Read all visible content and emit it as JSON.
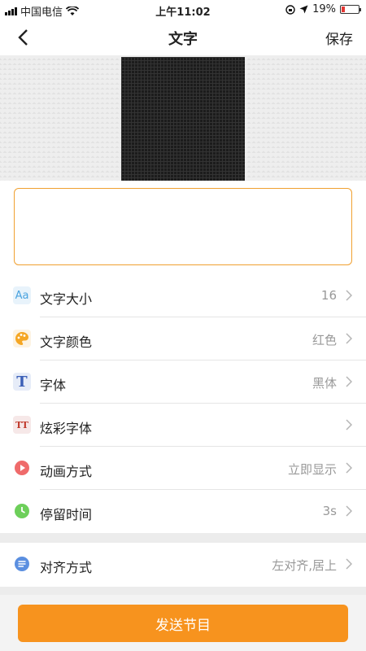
{
  "status_bar": {
    "carrier": "中国电信",
    "time": "上午11:02",
    "battery": "19%",
    "battery_level": 0.19
  },
  "nav": {
    "title": "文字",
    "save_label": "保存"
  },
  "preview": {
    "led_color": "#1c1c1c"
  },
  "text_input": {
    "value": ""
  },
  "settings": [
    {
      "icon": "font-size-icon",
      "icon_text": "Aa",
      "label": "文字大小",
      "value": "16"
    },
    {
      "icon": "palette-icon",
      "icon_text": "",
      "label": "文字颜色",
      "value": "红色"
    },
    {
      "icon": "font-family-icon",
      "icon_text": "T",
      "label": "字体",
      "value": "黑体"
    },
    {
      "icon": "fancy-font-icon",
      "icon_text": "TT",
      "label": "炫彩字体",
      "value": ""
    },
    {
      "icon": "play-icon",
      "icon_text": "",
      "label": "动画方式",
      "value": "立即显示"
    },
    {
      "icon": "clock-icon",
      "icon_text": "",
      "label": "停留时间",
      "value": "3s"
    }
  ],
  "settings_2": [
    {
      "icon": "align-icon",
      "label": "对齐方式",
      "value": "左对齐,居上"
    }
  ],
  "send_label": "发送节目",
  "colors": {
    "accent": "#f7931e",
    "input_border": "#f0a030"
  }
}
